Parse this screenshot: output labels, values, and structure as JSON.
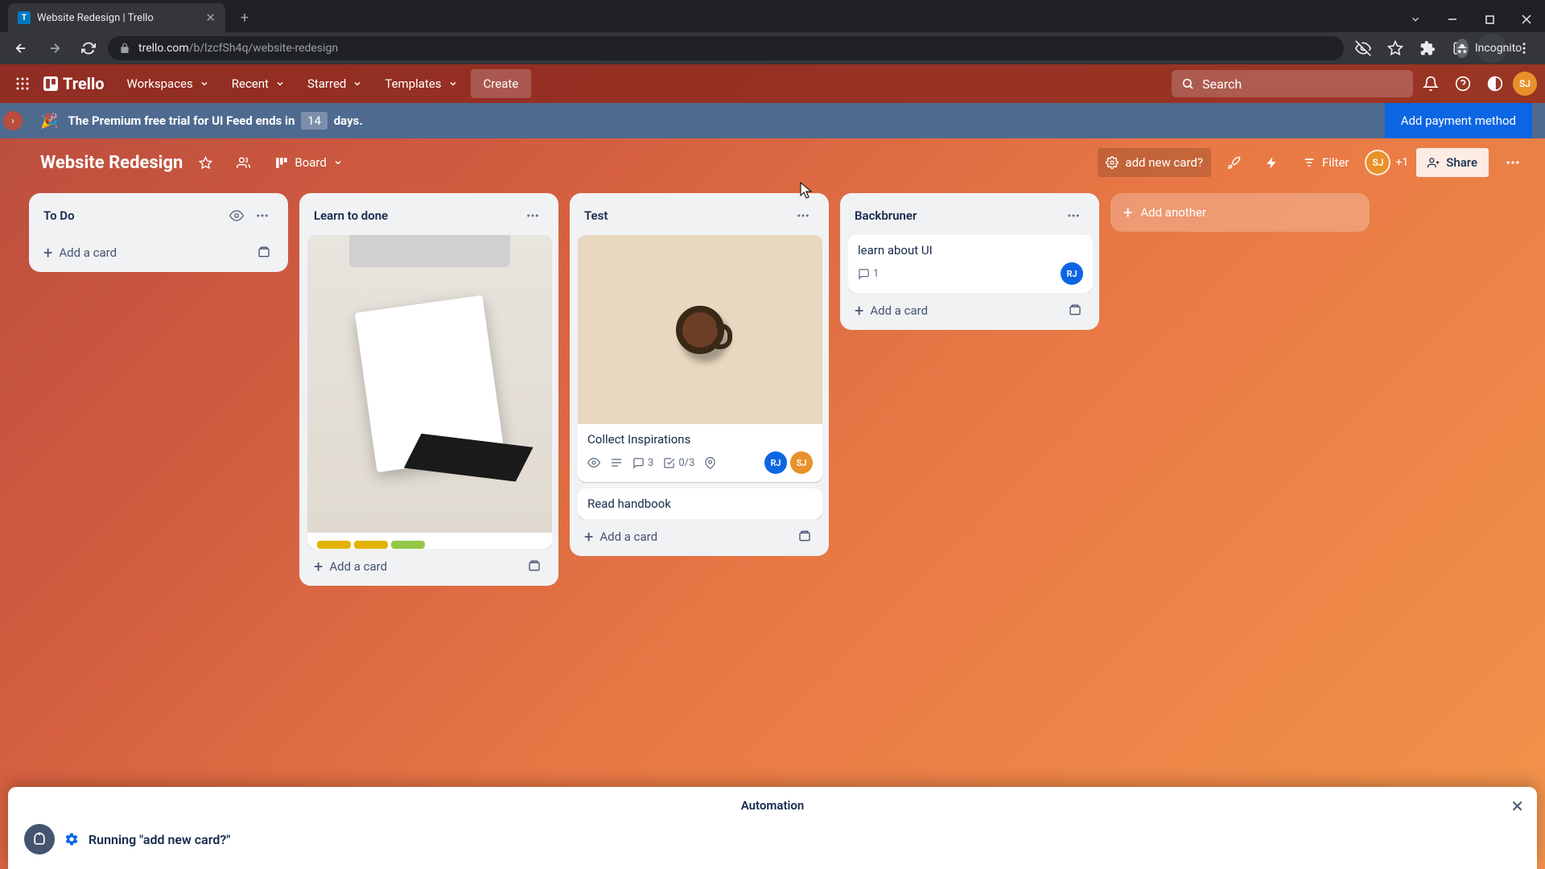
{
  "browser": {
    "tab_title": "Website Redesign | Trello",
    "url_domain": "trello.com",
    "url_path": "/b/lzcfSh4q/website-redesign",
    "incognito_label": "Incognito"
  },
  "header": {
    "workspaces": "Workspaces",
    "recent": "Recent",
    "starred": "Starred",
    "templates": "Templates",
    "create": "Create",
    "search_placeholder": "Search",
    "logo": "Trello"
  },
  "banner": {
    "text_pre": "The Premium free trial for UI Feed ends in",
    "days_count": "14",
    "text_post": "days.",
    "cta": "Add payment method"
  },
  "board": {
    "title": "Website Redesign",
    "view_label": "Board",
    "automation_btn": "add new card?",
    "filter": "Filter",
    "share": "Share",
    "member_extra": "+1",
    "add_list": "Add another"
  },
  "lists": {
    "todo": {
      "title": "To Do",
      "add": "Add a card"
    },
    "learn": {
      "title": "Learn to done",
      "add": "Add a card"
    },
    "test": {
      "title": "Test",
      "add": "Add a card",
      "card1_title": "Collect Inspirations",
      "card1_comments": "3",
      "card1_check": "0/3",
      "card2_title": "Read handbook"
    },
    "backburner": {
      "title": "Backbruner",
      "add": "Add a card",
      "card1_title": "learn about UI",
      "card1_comments": "1"
    }
  },
  "automation": {
    "title": "Automation",
    "running": "Running \"add new card?\""
  },
  "members": {
    "sj": "SJ",
    "rj": "RJ"
  }
}
